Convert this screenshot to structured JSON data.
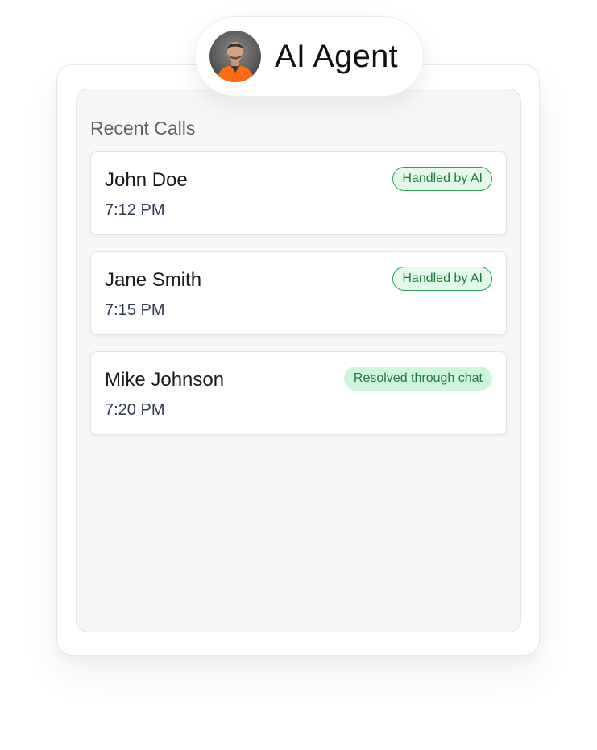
{
  "agent": {
    "title": "AI Agent",
    "avatar_icon": "person-avatar"
  },
  "recent_calls": {
    "title": "Recent Calls",
    "items": [
      {
        "name": "John Doe",
        "time": "7:12 PM",
        "status": "Handled by AI",
        "status_style": "outlined"
      },
      {
        "name": "Jane Smith",
        "time": "7:15 PM",
        "status": "Handled by AI",
        "status_style": "outlined"
      },
      {
        "name": "Mike Johnson",
        "time": "7:20 PM",
        "status": "Resolved through chat",
        "status_style": "filled"
      }
    ]
  },
  "colors": {
    "badge_text": "#1e7a3d",
    "badge_border": "#2f9e57",
    "badge_bg_outlined": "#e3f9ea",
    "badge_bg_filled": "#cdf5dc",
    "panel_bg": "#f7f7f7",
    "avatar_shirt": "#ff6a14"
  }
}
